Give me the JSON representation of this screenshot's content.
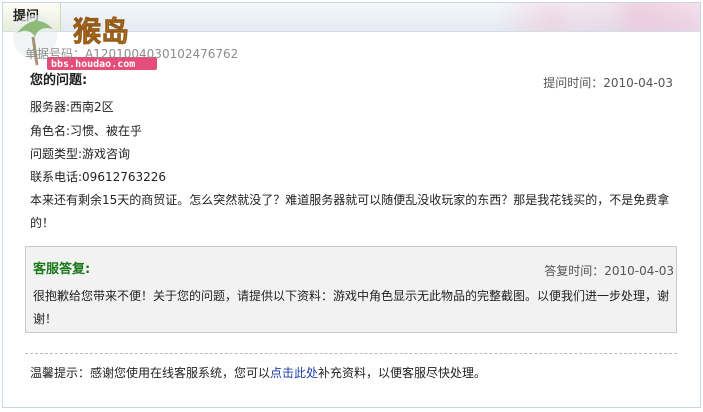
{
  "header": {
    "tab_label": "提问"
  },
  "watermark": {
    "text_main": "猴岛",
    "text_sub": "bbs.houdao.com"
  },
  "ticket": {
    "id_label": "单据号码：",
    "id_value": "A120100403010247676​2"
  },
  "question": {
    "title": "您的问题:",
    "time_label": "提问时间：",
    "time_value": "2010-04-03",
    "server": "服务器:西南2区",
    "role": "角色名:习惯、被在乎",
    "type": "问题类型:游戏咨询",
    "phone": "联系电话:09612763226",
    "content": "本来还有剩余15天的商贸证。怎么突然就没了？难道服务器就可以随便乱没收玩家的东西？那是我花钱买的，不是免费拿的！"
  },
  "reply": {
    "title": "客服答复:",
    "time_label": "答复时间：",
    "time_value": "2010-04-03",
    "content": "很抱歉给您带来不便！关于您的问题，请提供以下资料：游戏中角色显示无此物品的完整截图。以便我们进一步处理，谢谢！"
  },
  "tip": {
    "prefix": "温馨提示：感谢您使用在线客服系统，您可以",
    "link": "点击此处",
    "suffix": "补充资料，以便客服尽快处理。"
  }
}
